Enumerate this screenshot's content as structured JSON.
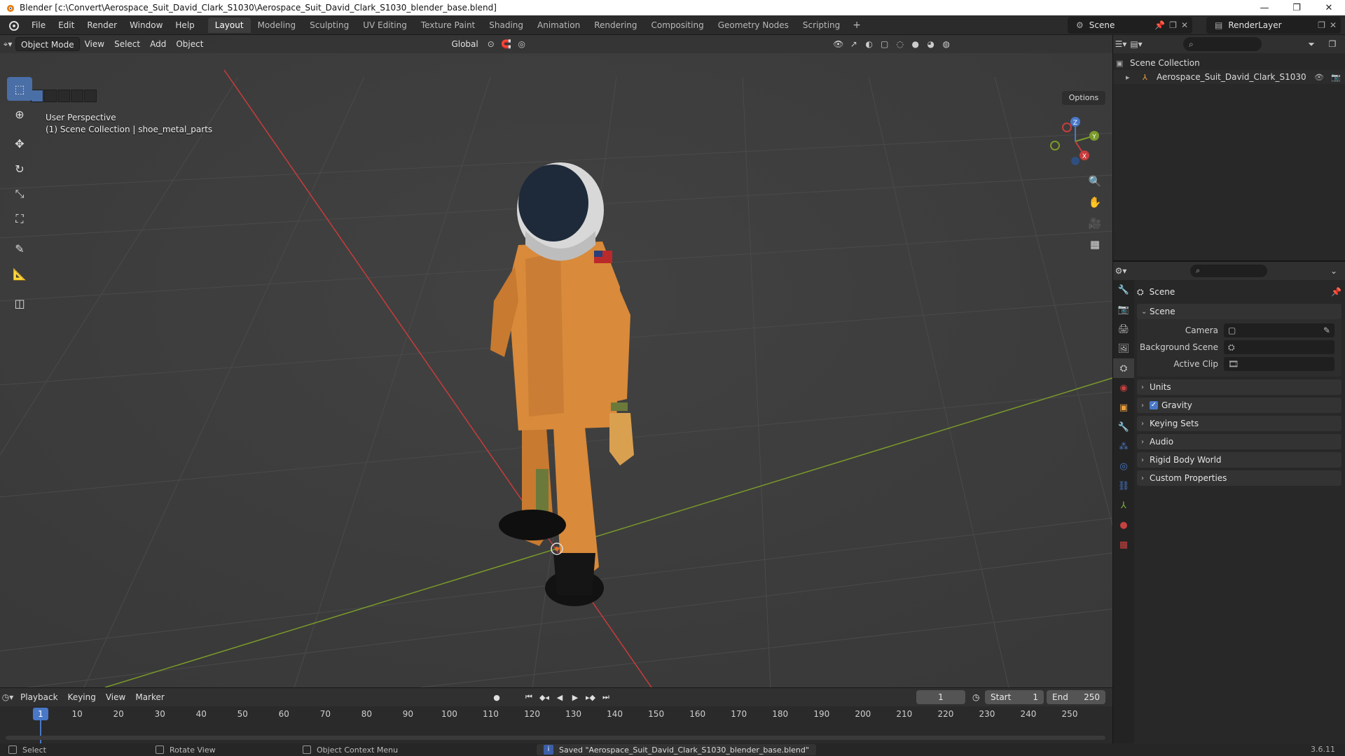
{
  "window": {
    "title": "Blender [c:\\Convert\\Aerospace_Suit_David_Clark_S1030\\Aerospace_Suit_David_Clark_S1030_blender_base.blend]"
  },
  "menus": [
    "File",
    "Edit",
    "Render",
    "Window",
    "Help"
  ],
  "workspace_tabs": [
    {
      "label": "Layout",
      "active": true
    },
    {
      "label": "Modeling"
    },
    {
      "label": "Sculpting"
    },
    {
      "label": "UV Editing"
    },
    {
      "label": "Texture Paint"
    },
    {
      "label": "Shading"
    },
    {
      "label": "Animation"
    },
    {
      "label": "Rendering"
    },
    {
      "label": "Compositing"
    },
    {
      "label": "Geometry Nodes"
    },
    {
      "label": "Scripting"
    }
  ],
  "add_tab_label": "+",
  "scene_selector": "Scene",
  "render_layer": "RenderLayer",
  "viewport": {
    "mode": "Object Mode",
    "header_menus": [
      "View",
      "Select",
      "Add",
      "Object"
    ],
    "transform_orientation": "Global",
    "options_label": "Options",
    "overlay_line1": "User Perspective",
    "overlay_line2": "(1) Scene Collection | shoe_metal_parts",
    "gizmo_axes": {
      "x": "X",
      "y": "Y",
      "z": "Z"
    }
  },
  "outliner": {
    "root": "Scene Collection",
    "object": "Aerospace_Suit_David_Clark_S1030"
  },
  "properties": {
    "context": "Scene",
    "panel_scene_title": "Scene",
    "fields": [
      {
        "label": "Camera"
      },
      {
        "label": "Background Scene"
      },
      {
        "label": "Active Clip"
      }
    ],
    "collapsed_panels": [
      "Units",
      "Gravity",
      "Keying Sets",
      "Audio",
      "Rigid Body World",
      "Custom Properties"
    ],
    "gravity_checked": true
  },
  "timeline": {
    "menus": [
      "Playback",
      "Keying",
      "View",
      "Marker"
    ],
    "current_frame": "1",
    "start_label": "Start",
    "start_value": "1",
    "end_label": "End",
    "end_value": "250",
    "ticks": [
      "1",
      "10",
      "20",
      "30",
      "40",
      "50",
      "60",
      "70",
      "80",
      "90",
      "100",
      "110",
      "120",
      "130",
      "140",
      "150",
      "160",
      "170",
      "180",
      "190",
      "200",
      "210",
      "220",
      "230",
      "240",
      "250"
    ]
  },
  "statusbar": {
    "select": "Select",
    "rotate": "Rotate View",
    "context_menu": "Object Context Menu",
    "message": "Saved \"Aerospace_Suit_David_Clark_S1030_blender_base.blend\"",
    "version": "3.6.11"
  },
  "colors": {
    "x_axis": "#c83c3c",
    "y_axis": "#7a9a2a",
    "accent": "#4a78c8",
    "suit": "#d98a3a"
  }
}
